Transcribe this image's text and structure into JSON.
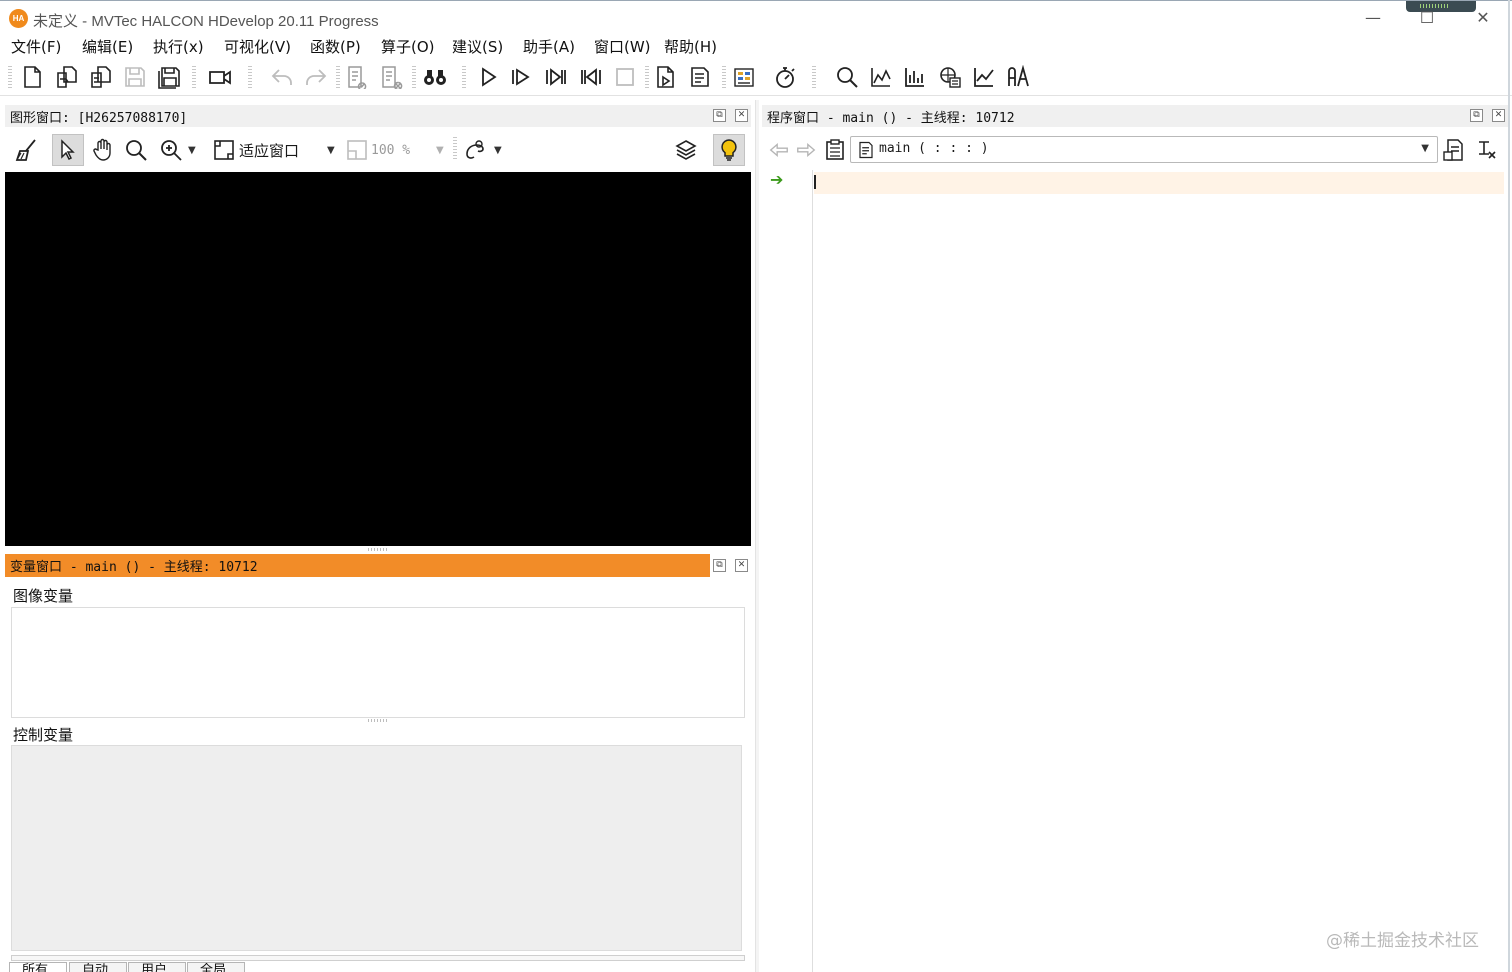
{
  "window": {
    "logo_text": "HA",
    "title": "未定义 - MVTec HALCON HDevelop 20.11 Progress",
    "minimize": "—",
    "maximize": "☐",
    "close": "✕"
  },
  "menu": [
    {
      "label": "文件(F)"
    },
    {
      "label": "编辑(E)"
    },
    {
      "label": "执行(x)"
    },
    {
      "label": "可视化(V)"
    },
    {
      "label": "函数(P)"
    },
    {
      "label": "算子(O)"
    },
    {
      "label": "建议(S)"
    },
    {
      "label": "助手(A)"
    },
    {
      "label": "窗口(W)"
    },
    {
      "label": "帮助(H)"
    }
  ],
  "graphics_window": {
    "title": "图形窗口: [H26257088170]",
    "fit_label": "适应窗口",
    "zoom_value": "100 %"
  },
  "variable_window": {
    "title": "变量窗口 - main () - 主线程: 10712",
    "image_vars_label": "图像变量",
    "control_vars_label": "控制变量",
    "tabs": [
      {
        "label": "所有"
      },
      {
        "label": "自动"
      },
      {
        "label": "用户"
      },
      {
        "label": "全局"
      }
    ]
  },
  "program_window": {
    "title": "程序窗口 - main () - 主线程: 10712",
    "procedure": "main ( : : : )",
    "pc_marker": "➔"
  },
  "panel_buttons": {
    "float": "⧉",
    "close": "✕"
  },
  "watermark": "@稀土掘金技术社区",
  "colors": {
    "accent_orange": "#f28c28",
    "canvas": "#000000",
    "current_line": "#fff3e6",
    "logo": "#f08a1c"
  }
}
